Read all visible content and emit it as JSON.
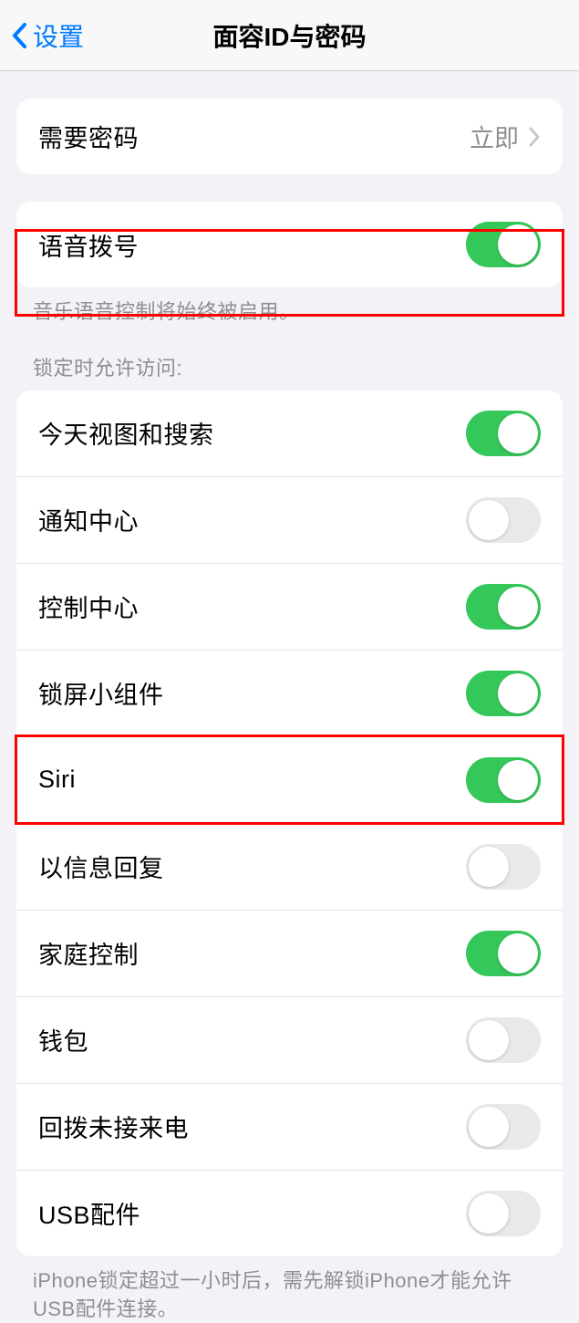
{
  "nav": {
    "back_label": "设置",
    "title": "面容ID与密码"
  },
  "passcode_group": {
    "require_passcode": {
      "label": "需要密码",
      "value": "立即"
    }
  },
  "voice_dial_group": {
    "voice_dial": {
      "label": "语音拨号",
      "enabled": true
    },
    "footer": "音乐语音控制将始终被启用。"
  },
  "lock_access": {
    "header": "锁定时允许访问:",
    "items": [
      {
        "label": "今天视图和搜索",
        "enabled": true
      },
      {
        "label": "通知中心",
        "enabled": false
      },
      {
        "label": "控制中心",
        "enabled": true
      },
      {
        "label": "锁屏小组件",
        "enabled": true
      },
      {
        "label": "Siri",
        "enabled": true
      },
      {
        "label": "以信息回复",
        "enabled": false
      },
      {
        "label": "家庭控制",
        "enabled": true
      },
      {
        "label": "钱包",
        "enabled": false
      },
      {
        "label": "回拨未接来电",
        "enabled": false
      },
      {
        "label": "USB配件",
        "enabled": false
      }
    ],
    "footer": "iPhone锁定超过一小时后，需先解锁iPhone才能允许USB配件连接。"
  },
  "highlights": {
    "voice_dial": true,
    "siri": true
  }
}
